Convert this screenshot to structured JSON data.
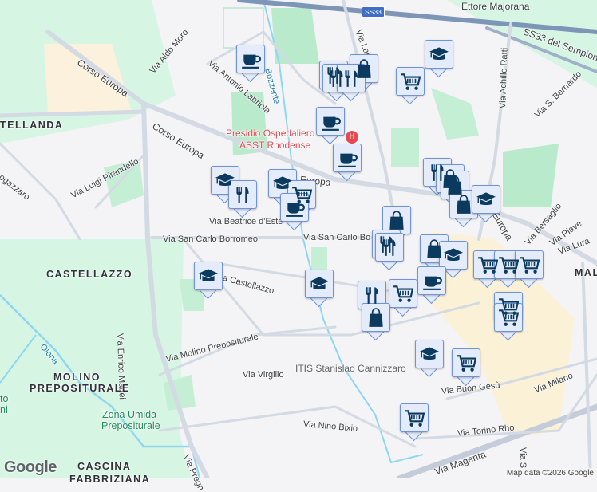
{
  "road_labels": {
    "corso_europa_1": "Corso Europa",
    "corso_europa_2": "Corso Europa",
    "europa_3": "Europa",
    "europa_4": "Europa",
    "via_aldo_moro": "Via Aldo Moro",
    "via_antonio_labriola": "Via Antonio Labriola",
    "via_lainate": "Via Lainate",
    "via_achille_ratti": "Via Achille Ratti",
    "ss33_sempione": "SS33 del Sempione",
    "via_s_bernardo": "Via S. Bernardo",
    "via_luigi_pirandello": "Via Luigi Pirandello",
    "fogazzaro": "ogazzaro",
    "via_beatrice_deste": "Via Beatrice d'Este",
    "via_san_carlo_borromeo": "Via San Carlo Borromeo",
    "via_san_carlo_bo": "Via San Carlo Bo",
    "via_castellazzo": "Via Castellazzo",
    "via_enrico_mattei": "Via Enrico Mattei",
    "via_molino_prepositurale": "Via Molino Prepositurale",
    "via_virgilio": "Via Virgilio",
    "via_nino_bixio": "Via Nino Bixio",
    "via_buon_gesu": "Via Buon Gesù",
    "via_milano": "Via Milano",
    "via_torino_rho": "Via Torino Rho",
    "via_magenta": "Via Magenta",
    "via_pregnana": "Via Pregn",
    "via_bersaglio": "Via Bersaglio",
    "via_piave": "Via Piave",
    "via_lura": "Via Lura",
    "via_s": "Via S",
    "elettore_majorana": "Ettore Majorana",
    "ss33_shield": "SS33"
  },
  "area_labels": {
    "castellanda": "TELLANDA",
    "castellazzo": "CASTELLAZZO",
    "molino_1": "MOLINO",
    "molino_2": "PREPOSITURALE",
    "cascina_1": "CASCINA",
    "cascina_2": "FABBRIZIANA",
    "mal": "MAL"
  },
  "poi_labels": {
    "hospital_1": "Presidio Ospedaliero",
    "hospital_2": "ASST Rhodense",
    "itis": "ITIS Stanislao Cannizzaro",
    "zona_umida_1": "Zona Umida",
    "zona_umida_2": "Prepositurale",
    "olona": "Olona",
    "bozzente": "Bozzente",
    "parco_1": "to",
    "parco_2": "ni"
  },
  "markers": [
    "cafe",
    "restaurant",
    "restaurant",
    "shop",
    "restaurant",
    "education",
    "cart",
    "cafe",
    "cafe",
    "education",
    "restaurant",
    "education",
    "cart",
    "cafe",
    "restaurant",
    "shop",
    "shop",
    "shop",
    "education",
    "shop",
    "restaurant",
    "restaurant",
    "shop",
    "education",
    "cafe",
    "cart",
    "cart",
    "cart",
    "education",
    "education",
    "restaurant",
    "cart",
    "shop",
    "cart",
    "cart",
    "education",
    "cart",
    "cart"
  ],
  "attribution": "Map data ©2026 Google",
  "logo": "Google",
  "hospital_pin": "H",
  "colors": {
    "marker_icon": "#0b3a5e",
    "marker_bg": "#e4ecfb",
    "park": "#c5efd5",
    "greenland": "#d6f6e3",
    "water": "#8fd6f2",
    "downtown": "#fbf1d6"
  }
}
